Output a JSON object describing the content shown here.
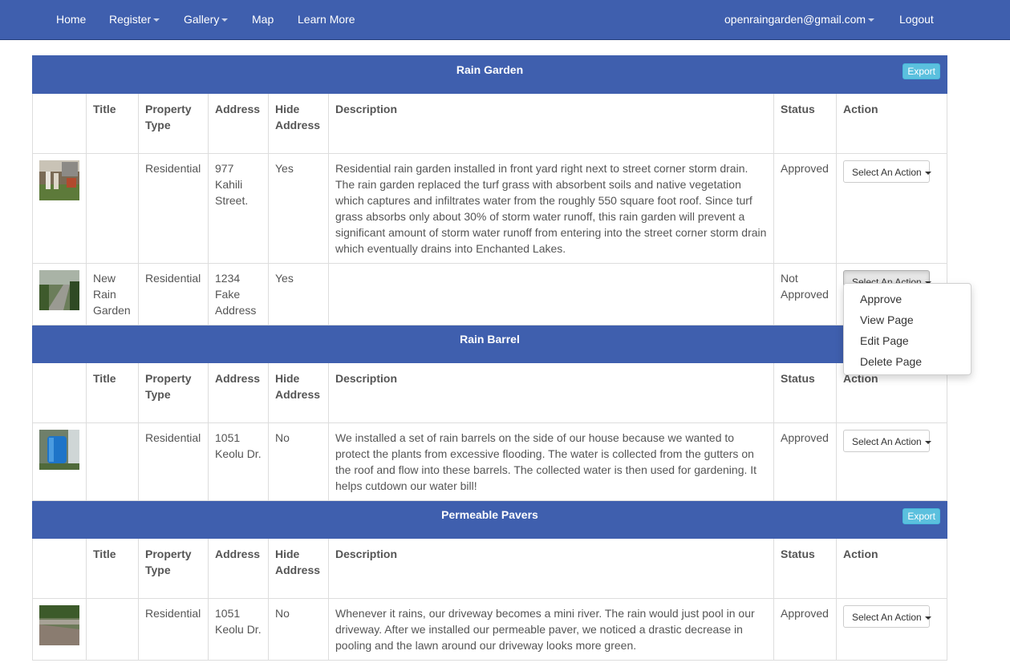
{
  "nav": {
    "home": "Home",
    "register": "Register",
    "gallery": "Gallery",
    "map": "Map",
    "learn_more": "Learn More",
    "user": "openraingarden@gmail.com",
    "logout": "Logout"
  },
  "headers": {
    "title": "Title",
    "property_type_1": "Property",
    "property_type_2": "Type",
    "address": "Address",
    "hide_1": "Hide",
    "hide_2": "Address",
    "description": "Description",
    "status": "Status",
    "action": "Action"
  },
  "export_label": "Export",
  "action_label": "Select An Action",
  "sections": [
    {
      "name": "Rain Garden",
      "rows": [
        {
          "title": "",
          "property": "Residential",
          "address": "977 Kahili Street.",
          "hide": "Yes",
          "description": "Residential rain garden installed in front yard right next to street corner storm drain. The rain garden replaced the turf grass with absorbent soils and native vegetation which captures and infiltrates water from the roughly 550 square foot roof. Since turf grass absorbs only about 30% of storm water runoff, this rain garden will prevent a significant amount of storm water runoff from entering into the street corner storm drain which eventually drains into Enchanted Lakes.",
          "status": "Approved"
        },
        {
          "title": "New Rain Garden",
          "property": "Residential",
          "address": "1234 Fake Address",
          "hide": "Yes",
          "description": "",
          "status": "Not Approved"
        }
      ]
    },
    {
      "name": "Rain Barrel",
      "rows": [
        {
          "title": "",
          "property": "Residential",
          "address": "1051 Keolu Dr.",
          "hide": "No",
          "description": "We installed a set of rain barrels on the side of our house because we wanted to protect the plants from excessive flooding. The water is collected from the gutters on the roof and flow into these barrels. The collected water is then used for gardening. It helps cutdown our water bill!",
          "status": "Approved"
        }
      ]
    },
    {
      "name": "Permeable Pavers",
      "rows": [
        {
          "title": "",
          "property": "Residential",
          "address": "1051 Keolu Dr.",
          "hide": "No",
          "description": "Whenever it rains, our driveway becomes a mini river. The rain would just pool in our driveway. After we installed our permeable paver, we noticed a drastic decrease in pooling and the lawn around our driveway looks more green.",
          "status": "Approved"
        }
      ]
    }
  ],
  "dropdown": {
    "approve": "Approve",
    "view": "View Page",
    "edit": "Edit Page",
    "delete": "Delete Page"
  }
}
